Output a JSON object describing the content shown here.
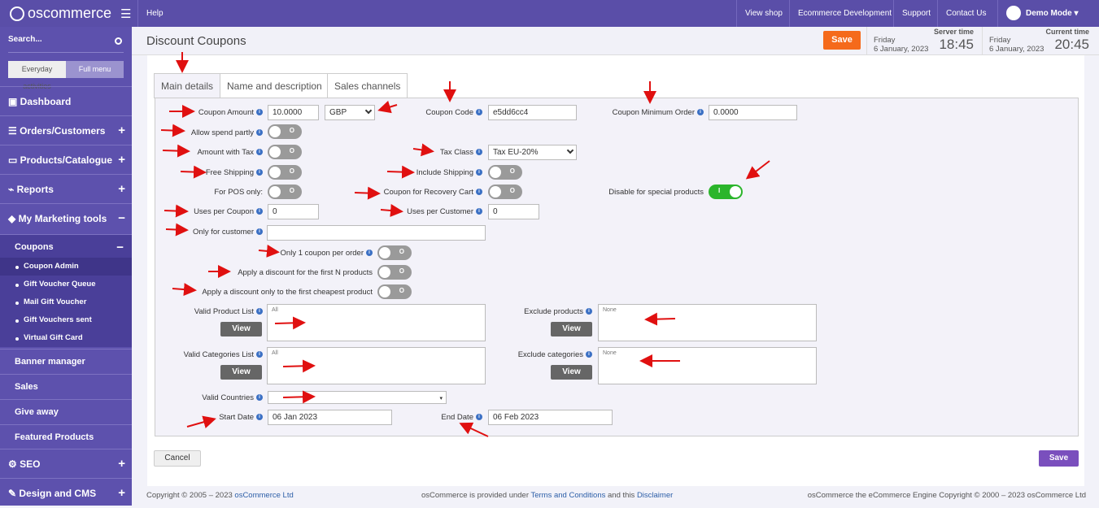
{
  "topbar": {
    "logo": "oscommerce",
    "help": "Help",
    "view_shop": "View shop",
    "ecom_dev": "Ecommerce Development",
    "support": "Support",
    "contact": "Contact Us",
    "demo": "Demo Mode"
  },
  "sidebar": {
    "search": "Search...",
    "tab_everyday": "Everyday activities",
    "tab_full": "Full menu",
    "dashboard": "Dashboard",
    "orders": "Orders/Customers",
    "products": "Products/Catalogue",
    "reports": "Reports",
    "marketing": "My Marketing tools",
    "coupons": "Coupons",
    "sub": [
      "Coupon Admin",
      "Gift Voucher Queue",
      "Mail Gift Voucher",
      "Gift Vouchers sent",
      "Virtual Gift Card"
    ],
    "banner": "Banner manager",
    "sales": "Sales",
    "giveaway": "Give away",
    "featured": "Featured Products",
    "seo": "SEO",
    "design": "Design and CMS"
  },
  "header": {
    "title": "Discount Coupons",
    "save": "Save",
    "server_label": "Server time",
    "server_day": "Friday",
    "server_date": "6 January, 2023",
    "server_time": "18:45",
    "current_label": "Current time",
    "current_day": "Friday",
    "current_date": "6 January, 2023",
    "current_time": "20:45"
  },
  "tabs": [
    "Main details",
    "Name and description",
    "Sales channels"
  ],
  "form": {
    "coupon_amount_label": "Coupon Amount",
    "coupon_amount": "10.0000",
    "currency": "GBP",
    "coupon_code_label": "Coupon Code",
    "coupon_code": "e5dd6cc4",
    "min_order_label": "Coupon Minimum Order",
    "min_order": "0.0000",
    "allow_spend": "Allow spend partly",
    "amount_tax": "Amount with Tax",
    "tax_class_label": "Tax Class",
    "tax_class": "Tax EU-20%",
    "free_shipping": "Free Shipping",
    "include_shipping": "Include Shipping",
    "pos_only": "For POS only:",
    "recovery": "Coupon for Recovery Cart",
    "disable_special": "Disable for special products",
    "uses_coupon_label": "Uses per Coupon",
    "uses_coupon": "0",
    "uses_customer_label": "Uses per Customer",
    "uses_customer": "0",
    "only_customer": "Only for customer",
    "one_coupon": "Only 1 coupon per order",
    "first_n": "Apply a discount for the first N products",
    "cheapest": "Apply a discount only to the first cheapest product",
    "valid_products": "Valid Product List",
    "valid_products_val": "All",
    "exclude_products": "Exclude products",
    "exclude_products_val": "None",
    "valid_categories": "Valid Categories List",
    "valid_categories_val": "All",
    "exclude_categories": "Exclude categories",
    "exclude_categories_val": "None",
    "view": "View",
    "valid_countries": "Valid Countries",
    "start_label": "Start Date",
    "start": "06 Jan 2023",
    "end_label": "End Date",
    "end": "06 Feb 2023",
    "toggle_off": "O",
    "toggle_on": "I"
  },
  "buttons": {
    "cancel": "Cancel",
    "save": "Save"
  },
  "footer": {
    "copy1": "Copyright © 2005 – 2023 ",
    "copy1_link": "osCommerce Ltd",
    "mid1": "osCommerce is provided under ",
    "terms": "Terms and Conditions",
    "mid2": " and this ",
    "disclaimer": "Disclaimer",
    "right": "osCommerce the eCommerce Engine Copyright © 2000 – 2023 osCommerce Ltd"
  },
  "colors": {
    "brand": "#5a4ea8",
    "save": "#f56a1b",
    "toggle_on": "#2bb52b",
    "arrow": "#e01010"
  }
}
